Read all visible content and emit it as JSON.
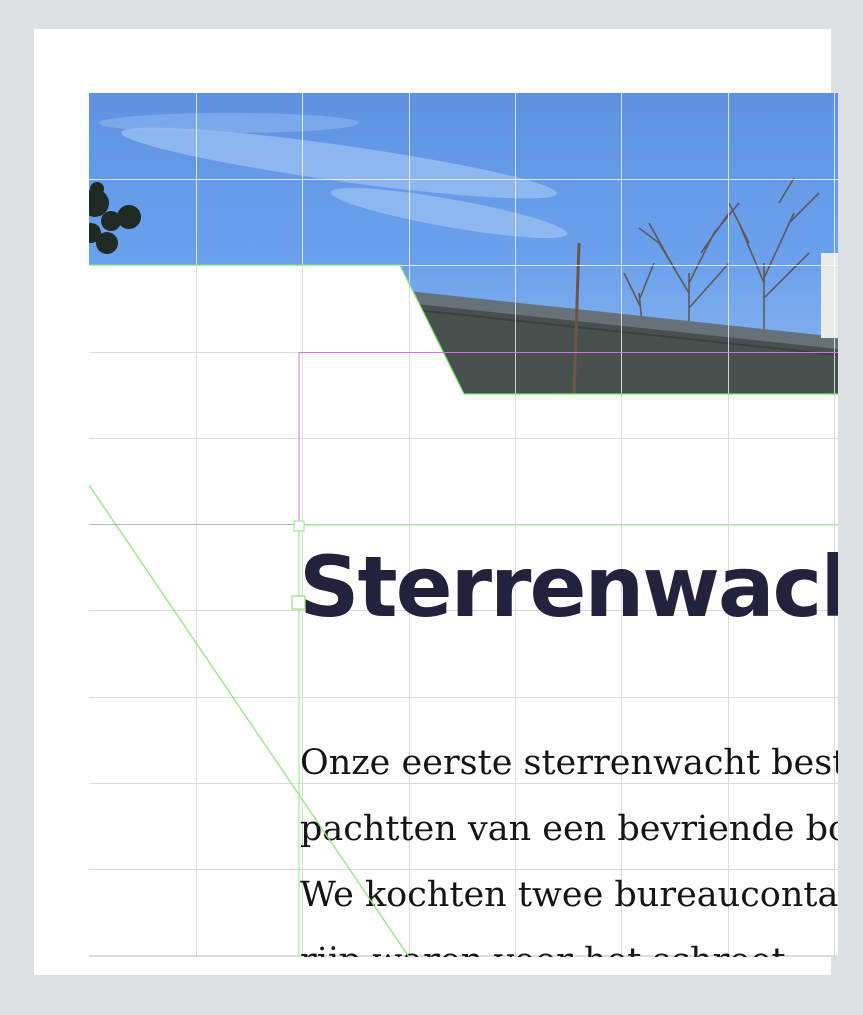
{
  "article": {
    "title": "Sterrenwacht",
    "paragraph_lines": [
      "Onze eerste sterrenwacht bestond",
      "pachtten van een bevriende boer.",
      "We kochten twee bureaucontainers",
      "rijp waren voor het schroot"
    ]
  },
  "hero_image": {
    "subject": "sky with bare trees and a flat-roofed building"
  },
  "colors": {
    "workspace_bg": "#dce0e3",
    "page_bg": "#ffffff",
    "title_text": "#23213b",
    "body_text": "#151515",
    "grid_line": "#dcdcdc",
    "shape_outline": "#7de36d",
    "frame_outline": "#cf74e6"
  }
}
